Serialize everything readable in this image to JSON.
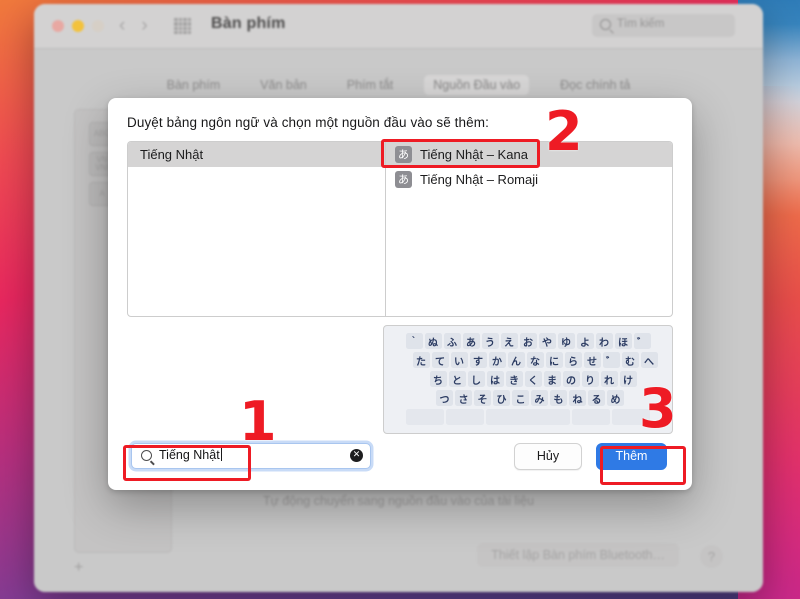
{
  "window": {
    "title": "Bàn phím",
    "search_placeholder": "Tìm kiếm",
    "traffic_lights": [
      "close-red",
      "minimize-yellow",
      "zoom-green"
    ],
    "nav_back": "‹",
    "nav_forward": "›",
    "grid_icon": "apps-grid-icon"
  },
  "tabs": [
    {
      "label": "Bàn phím",
      "selected": false
    },
    {
      "label": "Văn bản",
      "selected": false
    },
    {
      "label": "Phím tắt",
      "selected": false
    },
    {
      "label": "Nguồn Đầu vào",
      "selected": true
    },
    {
      "label": "Đọc chính tả",
      "selected": false
    }
  ],
  "background": {
    "input_sources": [
      "ABC",
      "VN\nVNI",
      "A"
    ],
    "add_button": "+",
    "auto_switch_label": "Tự động chuyển sang nguồn đầu vào của tài liệu",
    "bluetooth_button": "Thiết lập Bàn phím Bluetooth…",
    "help_button": "?"
  },
  "sheet": {
    "prompt": "Duyệt bảng ngôn ngữ và chọn một nguồn đầu vào sẽ thêm:",
    "languages": [
      {
        "label": "Tiếng Nhật",
        "selected": true
      }
    ],
    "sources": [
      {
        "label": "Tiếng Nhật – Kana",
        "icon": "あ",
        "selected": true
      },
      {
        "label": "Tiếng Nhật – Romaji",
        "icon": "あ",
        "selected": false
      }
    ],
    "search": {
      "value": "Tiếng Nhật",
      "icon": "search-icon",
      "clear_icon": "✕"
    },
    "cancel_label": "Hủy",
    "add_label": "Thêm"
  },
  "keyboard_preview": {
    "rows": [
      [
        "`",
        "ぬ",
        "ふ",
        "あ",
        "う",
        "え",
        "お",
        "や",
        "ゆ",
        "よ",
        "わ",
        "ほ",
        "゛"
      ],
      [
        "た",
        "て",
        "い",
        "す",
        "か",
        "ん",
        "な",
        "に",
        "ら",
        "せ",
        "゛",
        "む",
        "へ"
      ],
      [
        "ち",
        "と",
        "し",
        "は",
        "き",
        "く",
        "ま",
        "の",
        "り",
        "れ",
        "け"
      ],
      [
        "つ",
        "さ",
        "そ",
        "ひ",
        "こ",
        "み",
        "も",
        "ね",
        "る",
        "め"
      ]
    ]
  },
  "annotations": [
    {
      "number": "1",
      "target": "search-field"
    },
    {
      "number": "2",
      "target": "kana-source-row"
    },
    {
      "number": "3",
      "target": "add-button"
    }
  ],
  "colors": {
    "accent_blue": "#2f7ae5",
    "annotation_red": "#ee1b24",
    "selection_gray": "#d5d4d4"
  }
}
